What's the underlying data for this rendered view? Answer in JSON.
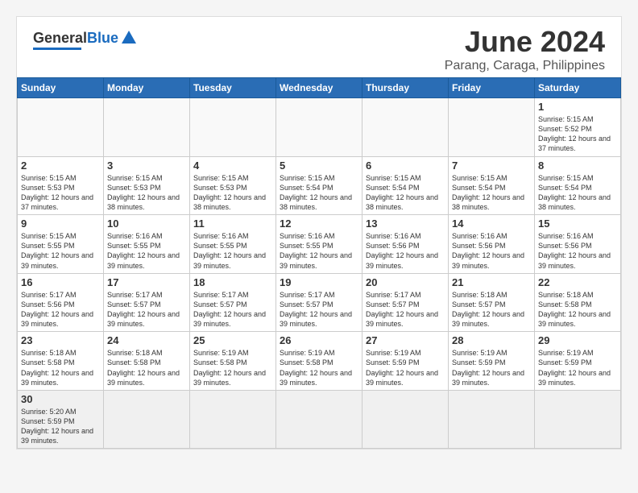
{
  "header": {
    "logo_general": "General",
    "logo_blue": "Blue",
    "month_year": "June 2024",
    "location": "Parang, Caraga, Philippines"
  },
  "weekdays": [
    "Sunday",
    "Monday",
    "Tuesday",
    "Wednesday",
    "Thursday",
    "Friday",
    "Saturday"
  ],
  "days": [
    {
      "date": 1,
      "sunrise": "5:15 AM",
      "sunset": "5:52 PM",
      "daylight": "12 hours and 37 minutes."
    },
    {
      "date": 2,
      "sunrise": "5:15 AM",
      "sunset": "5:53 PM",
      "daylight": "12 hours and 37 minutes."
    },
    {
      "date": 3,
      "sunrise": "5:15 AM",
      "sunset": "5:53 PM",
      "daylight": "12 hours and 38 minutes."
    },
    {
      "date": 4,
      "sunrise": "5:15 AM",
      "sunset": "5:53 PM",
      "daylight": "12 hours and 38 minutes."
    },
    {
      "date": 5,
      "sunrise": "5:15 AM",
      "sunset": "5:54 PM",
      "daylight": "12 hours and 38 minutes."
    },
    {
      "date": 6,
      "sunrise": "5:15 AM",
      "sunset": "5:54 PM",
      "daylight": "12 hours and 38 minutes."
    },
    {
      "date": 7,
      "sunrise": "5:15 AM",
      "sunset": "5:54 PM",
      "daylight": "12 hours and 38 minutes."
    },
    {
      "date": 8,
      "sunrise": "5:15 AM",
      "sunset": "5:54 PM",
      "daylight": "12 hours and 38 minutes."
    },
    {
      "date": 9,
      "sunrise": "5:15 AM",
      "sunset": "5:55 PM",
      "daylight": "12 hours and 39 minutes."
    },
    {
      "date": 10,
      "sunrise": "5:16 AM",
      "sunset": "5:55 PM",
      "daylight": "12 hours and 39 minutes."
    },
    {
      "date": 11,
      "sunrise": "5:16 AM",
      "sunset": "5:55 PM",
      "daylight": "12 hours and 39 minutes."
    },
    {
      "date": 12,
      "sunrise": "5:16 AM",
      "sunset": "5:55 PM",
      "daylight": "12 hours and 39 minutes."
    },
    {
      "date": 13,
      "sunrise": "5:16 AM",
      "sunset": "5:56 PM",
      "daylight": "12 hours and 39 minutes."
    },
    {
      "date": 14,
      "sunrise": "5:16 AM",
      "sunset": "5:56 PM",
      "daylight": "12 hours and 39 minutes."
    },
    {
      "date": 15,
      "sunrise": "5:16 AM",
      "sunset": "5:56 PM",
      "daylight": "12 hours and 39 minutes."
    },
    {
      "date": 16,
      "sunrise": "5:17 AM",
      "sunset": "5:56 PM",
      "daylight": "12 hours and 39 minutes."
    },
    {
      "date": 17,
      "sunrise": "5:17 AM",
      "sunset": "5:57 PM",
      "daylight": "12 hours and 39 minutes."
    },
    {
      "date": 18,
      "sunrise": "5:17 AM",
      "sunset": "5:57 PM",
      "daylight": "12 hours and 39 minutes."
    },
    {
      "date": 19,
      "sunrise": "5:17 AM",
      "sunset": "5:57 PM",
      "daylight": "12 hours and 39 minutes."
    },
    {
      "date": 20,
      "sunrise": "5:17 AM",
      "sunset": "5:57 PM",
      "daylight": "12 hours and 39 minutes."
    },
    {
      "date": 21,
      "sunrise": "5:18 AM",
      "sunset": "5:57 PM",
      "daylight": "12 hours and 39 minutes."
    },
    {
      "date": 22,
      "sunrise": "5:18 AM",
      "sunset": "5:58 PM",
      "daylight": "12 hours and 39 minutes."
    },
    {
      "date": 23,
      "sunrise": "5:18 AM",
      "sunset": "5:58 PM",
      "daylight": "12 hours and 39 minutes."
    },
    {
      "date": 24,
      "sunrise": "5:18 AM",
      "sunset": "5:58 PM",
      "daylight": "12 hours and 39 minutes."
    },
    {
      "date": 25,
      "sunrise": "5:19 AM",
      "sunset": "5:58 PM",
      "daylight": "12 hours and 39 minutes."
    },
    {
      "date": 26,
      "sunrise": "5:19 AM",
      "sunset": "5:58 PM",
      "daylight": "12 hours and 39 minutes."
    },
    {
      "date": 27,
      "sunrise": "5:19 AM",
      "sunset": "5:59 PM",
      "daylight": "12 hours and 39 minutes."
    },
    {
      "date": 28,
      "sunrise": "5:19 AM",
      "sunset": "5:59 PM",
      "daylight": "12 hours and 39 minutes."
    },
    {
      "date": 29,
      "sunrise": "5:19 AM",
      "sunset": "5:59 PM",
      "daylight": "12 hours and 39 minutes."
    },
    {
      "date": 30,
      "sunrise": "5:20 AM",
      "sunset": "5:59 PM",
      "daylight": "12 hours and 39 minutes."
    }
  ]
}
